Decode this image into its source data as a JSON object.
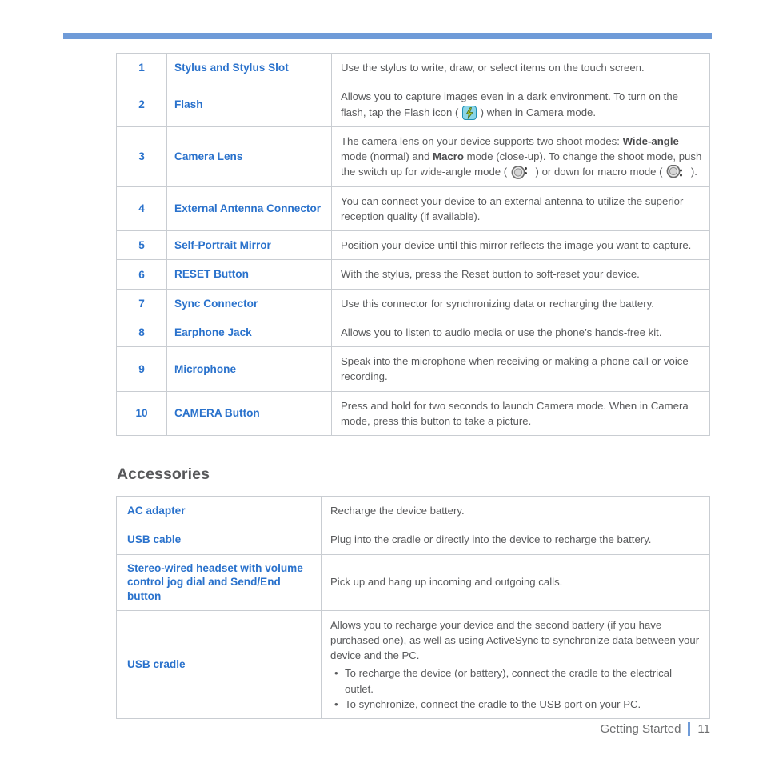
{
  "document": {
    "section_heading": "Accessories",
    "footer": {
      "chapter": "Getting Started",
      "page_number": "11"
    },
    "accent_color": "#6f9bd8",
    "link_color": "#2a72cc",
    "body_color": "#58595b"
  },
  "features_table": {
    "rows": [
      {
        "num": "1",
        "name": "Stylus and Stylus Slot",
        "desc": "Use the stylus to write, draw, or select items on the touch screen."
      },
      {
        "num": "2",
        "name": "Flash",
        "desc_part1": "Allows you to capture images even in a dark environment. To turn on the flash, tap the Flash icon ( ",
        "icon": "flash-icon",
        "desc_part2": " ) when in Camera mode."
      },
      {
        "num": "3",
        "name": "Camera Lens",
        "desc_part1": "The camera lens on your device supports two shoot modes: ",
        "bold1": "Wide-angle",
        "desc_part2": " mode (normal) and ",
        "bold2": "Macro",
        "desc_part3": " mode (close-up). To change the shoot mode, push the switch up for wide-angle mode ( ",
        "icon1": "wide-angle-switch-icon",
        "desc_part4": " ) or down for macro mode ( ",
        "icon2": "macro-switch-icon",
        "desc_part5": " )."
      },
      {
        "num": "4",
        "name": "External Antenna Connector",
        "desc": "You can connect your device to an external antenna to utilize the superior reception quality (if available)."
      },
      {
        "num": "5",
        "name": "Self-Portrait Mirror",
        "desc": "Position your device until this mirror reflects the image you want to capture."
      },
      {
        "num": "6",
        "name": "RESET Button",
        "desc": "With the stylus, press the Reset button to soft-reset your device."
      },
      {
        "num": "7",
        "name": "Sync Connector",
        "desc": "Use this connector for synchronizing data or recharging the battery."
      },
      {
        "num": "8",
        "name": "Earphone Jack",
        "desc": "Allows you to listen to audio media or use the phone’s hands-free kit."
      },
      {
        "num": "9",
        "name": "Microphone",
        "desc": "Speak into the microphone when receiving or making a phone call or voice recording."
      },
      {
        "num": "10",
        "name": "CAMERA Button",
        "desc": "Press and hold for two seconds to launch Camera mode. When in Camera mode, press this button to take a picture."
      }
    ]
  },
  "accessories_table": {
    "rows": [
      {
        "name": "AC adapter",
        "desc": "Recharge the device battery."
      },
      {
        "name": "USB cable",
        "desc": "Plug into the cradle or directly into the device to recharge the battery."
      },
      {
        "name": "Stereo-wired headset with volume control jog dial and Send/End button",
        "desc": "Pick up and hang up incoming and outgoing calls."
      },
      {
        "name": "USB cradle",
        "desc": "Allows you to recharge your device and the second battery (if you have purchased one), as well as using ActiveSync to synchronize data between your device and the PC.",
        "bullets": [
          "To recharge the device (or battery), connect the cradle to the electrical outlet.",
          "To synchronize, connect the cradle to the USB port on your PC."
        ]
      }
    ]
  }
}
